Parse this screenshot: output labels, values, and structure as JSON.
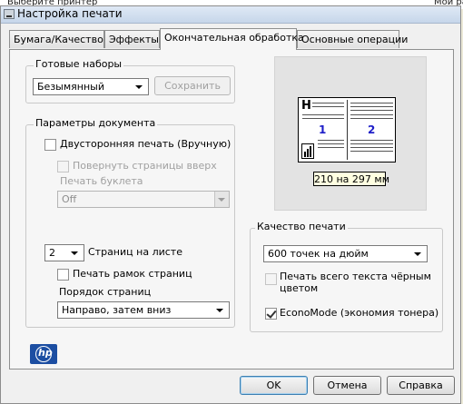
{
  "background": {
    "left_text": "Выберите принтер",
    "right_text": "Мои раст"
  },
  "dialog": {
    "title": "Настройка печати",
    "close_button": "✕"
  },
  "tabs": [
    {
      "label": "Бумага/Качество"
    },
    {
      "label": "Эффекты"
    },
    {
      "label": "Окончательная обработка",
      "active": true
    },
    {
      "label": "Основные операции"
    }
  ],
  "presets": {
    "group_label": "Готовые наборы",
    "selected": "Безымянный",
    "save_button": "Сохранить"
  },
  "document_options": {
    "group_label": "Параметры документа",
    "duplex_label": "Двусторонняя печать (Вручную)",
    "duplex_checked": false,
    "flip_pages_label": "Повернуть страницы вверх",
    "booklet_label": "Печать буклета",
    "booklet_value": "Off",
    "pages_per_sheet_value": "2",
    "pages_per_sheet_label": "Страниц на листе",
    "print_borders_label": "Печать рамок страниц",
    "page_order_label": "Порядок страниц",
    "page_order_value": "Направо, затем вниз"
  },
  "preview": {
    "page1": "1",
    "page2": "2",
    "header_mark": "H",
    "size_label": "210 на 297 мм"
  },
  "print_quality": {
    "group_label": "Качество печати",
    "resolution_value": "600 точек на дюйм",
    "all_text_black_label": "Печать всего текста чёрным цветом",
    "all_text_black_checked": false,
    "economode_label": "EconoMode (экономия тонера)",
    "economode_checked": true
  },
  "logo": {
    "text": "hp"
  },
  "buttons": {
    "ok": "OK",
    "cancel": "Отмена",
    "help": "Справка"
  },
  "colors": {
    "logo_blue": "#1c4ea2",
    "page_number_blue": "#1e1ec8",
    "tooltip_yellow": "#ffffe1"
  }
}
